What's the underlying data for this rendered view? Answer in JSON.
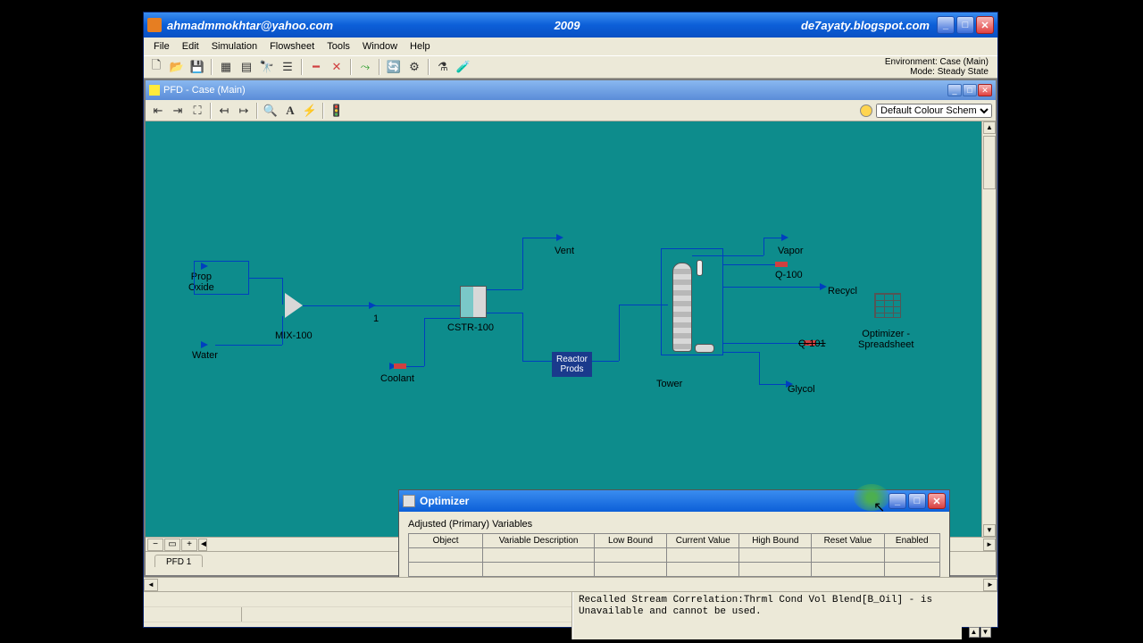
{
  "titlebar": {
    "left": "ahmadmmokhtar@yahoo.com",
    "center": "2009",
    "right": "de7ayaty.blogspot.com"
  },
  "menu": {
    "file": "File",
    "edit": "Edit",
    "simulation": "Simulation",
    "flowsheet": "Flowsheet",
    "tools": "Tools",
    "window": "Window",
    "help": "Help"
  },
  "env": {
    "line1": "Environment: Case (Main)",
    "line2": "Mode: Steady State"
  },
  "pfd": {
    "title": "PFD - Case (Main)",
    "tab": "PFD 1",
    "scheme_default": "Default Colour Scheme"
  },
  "nodes": {
    "prop_oxide": "Prop\nOxide",
    "water": "Water",
    "mix100": "MIX-100",
    "one": "1",
    "coolant": "Coolant",
    "cstr100": "CSTR-100",
    "vent": "Vent",
    "reactor_prods": "Reactor\nProds",
    "tower": "Tower",
    "vapor": "Vapor",
    "q100": "Q-100",
    "recycl": "Recycl",
    "q101": "Q-101",
    "glycol": "Glycol",
    "optimizer_ss": "Optimizer -\nSpreadsheet"
  },
  "optimizer": {
    "title": "Optimizer",
    "section": "Adjusted (Primary) Variables",
    "cols": {
      "object": "Object",
      "vardesc": "Variable Description",
      "lowbound": "Low Bound",
      "current": "Current Value",
      "highbound": "High Bound",
      "reset": "Reset Value",
      "enabled": "Enabled"
    }
  },
  "status": {
    "msg": "Recalled Stream Correlation:Thrml Cond Vol Blend[B_Oil] - is Unavailable and cannot be used."
  }
}
